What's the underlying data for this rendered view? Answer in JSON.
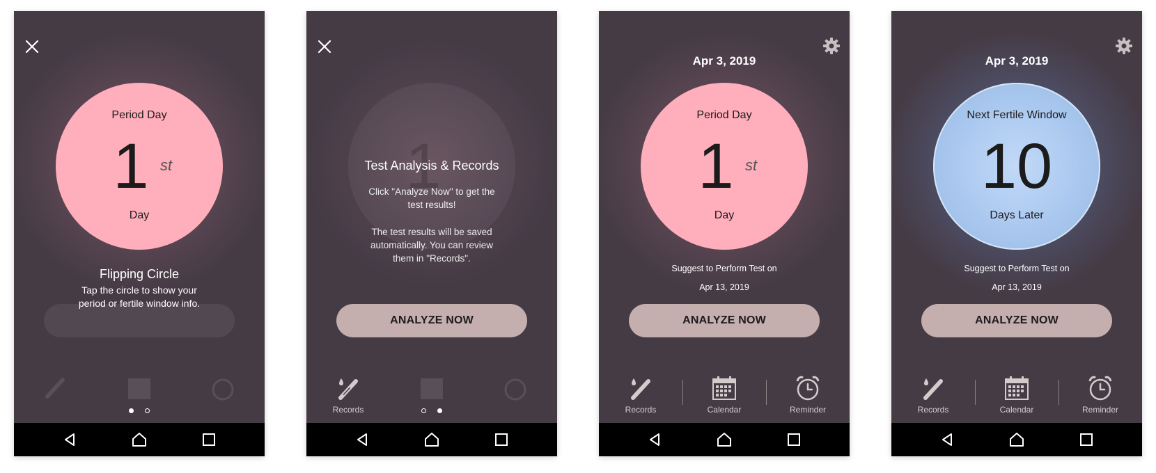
{
  "screens": [
    {
      "circle": {
        "top": "Period Day",
        "number": "1",
        "suffix": "st",
        "bottom": "Day"
      },
      "tip": {
        "title": "Flipping Circle",
        "text_1": "Tap the circle to show your",
        "text_2": "period or fertile window info."
      }
    },
    {
      "circle": {
        "number": "1"
      },
      "overlay": {
        "title": "Test Analysis & Records",
        "text_1": "Click \"Analyze Now\" to get the",
        "text_2": "test results!",
        "text_3": "The test results will be saved",
        "text_4": "automatically. You can review",
        "text_5": "them in \"Records\"."
      },
      "button": "ANALYZE NOW",
      "tabs": [
        "Records"
      ]
    },
    {
      "date": "Apr 3, 2019",
      "circle": {
        "top": "Period Day",
        "number": "1",
        "suffix": "st",
        "bottom": "Day"
      },
      "suggest": "Suggest to Perform Test on",
      "suggest_date": "Apr 13, 2019",
      "button": "ANALYZE NOW",
      "tabs": [
        "Records",
        "Calendar",
        "Reminder"
      ]
    },
    {
      "date": "Apr 3, 2019",
      "circle": {
        "top": "Next Fertile Window",
        "number": "10",
        "bottom": "Days Later"
      },
      "suggest": "Suggest to Perform Test on",
      "suggest_date": "Apr 13, 2019",
      "button": "ANALYZE NOW",
      "tabs": [
        "Records",
        "Calendar",
        "Reminder"
      ]
    }
  ],
  "icons": {
    "close": "close-icon",
    "settings": "gear-icon",
    "records": "test-strip-icon",
    "calendar": "calendar-icon",
    "reminder": "alarm-clock-icon",
    "nav_back": "back-triangle-icon",
    "nav_home": "home-icon",
    "nav_recent": "recent-apps-icon"
  },
  "colors": {
    "background": "#453b45",
    "period_circle": "#ffaebb",
    "fertile_circle": "#a7c6ee",
    "button": "#c4afae"
  },
  "pager": {
    "screen_1_active": 1,
    "screen_2_active": 2,
    "total": 2
  }
}
